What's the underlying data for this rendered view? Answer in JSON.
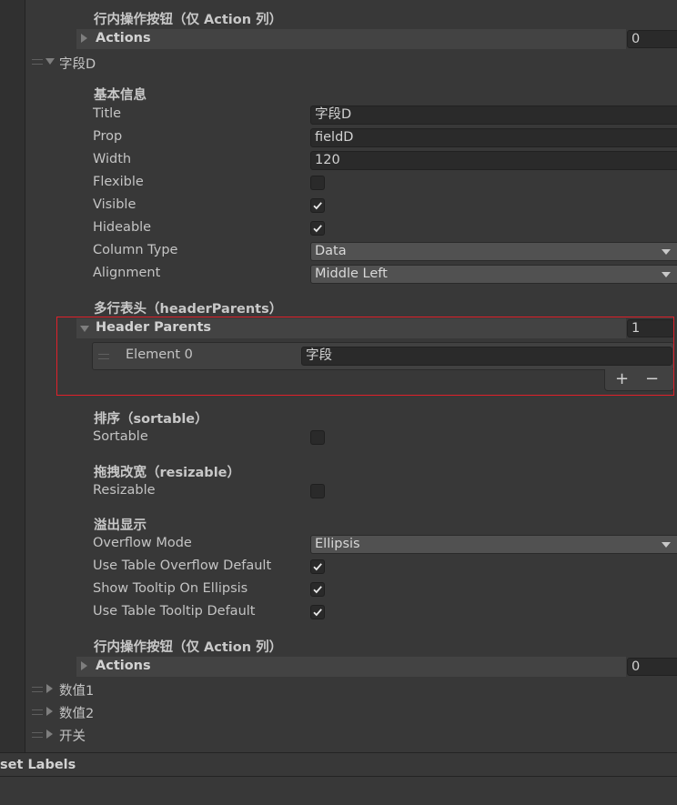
{
  "top": {
    "section_title": "行内操作按钮（仅 Action 列）",
    "actions_label": "Actions",
    "actions_count": "0"
  },
  "field_d": {
    "label": "字段D",
    "basic_title": "基本信息",
    "title_label": "Title",
    "title_value": "字段D",
    "prop_label": "Prop",
    "prop_value": "fieldD",
    "width_label": "Width",
    "width_value": "120",
    "flexible_label": "Flexible",
    "flexible_checked": false,
    "visible_label": "Visible",
    "visible_checked": true,
    "hideable_label": "Hideable",
    "hideable_checked": true,
    "column_type_label": "Column Type",
    "column_type_value": "Data",
    "alignment_label": "Alignment",
    "alignment_value": "Middle Left",
    "header_parents_title": "多行表头（headerParents）",
    "header_parents_label": "Header Parents",
    "header_parents_count": "1",
    "element0_label": "Element 0",
    "element0_value": "字段",
    "add_symbol": "+",
    "remove_symbol": "−",
    "sort_title": "排序（sortable）",
    "sortable_label": "Sortable",
    "sortable_checked": false,
    "resize_title": "拖拽改宽（resizable）",
    "resizable_label": "Resizable",
    "resizable_checked": false,
    "overflow_title": "溢出显示",
    "overflow_mode_label": "Overflow Mode",
    "overflow_mode_value": "Ellipsis",
    "use_table_overflow_label": "Use Table Overflow Default",
    "use_table_overflow_checked": true,
    "show_tooltip_label": "Show Tooltip On Ellipsis",
    "show_tooltip_checked": true,
    "use_table_tooltip_label": "Use Table Tooltip Default",
    "use_table_tooltip_checked": true,
    "action_title": "行内操作按钮（仅 Action 列）",
    "actions_label": "Actions",
    "actions_count": "0"
  },
  "other_fields": [
    "数值1",
    "数值2",
    "开关"
  ],
  "bottom_label": "set Labels",
  "colors": {
    "highlight": "#e0202a",
    "panel": "#383838"
  }
}
